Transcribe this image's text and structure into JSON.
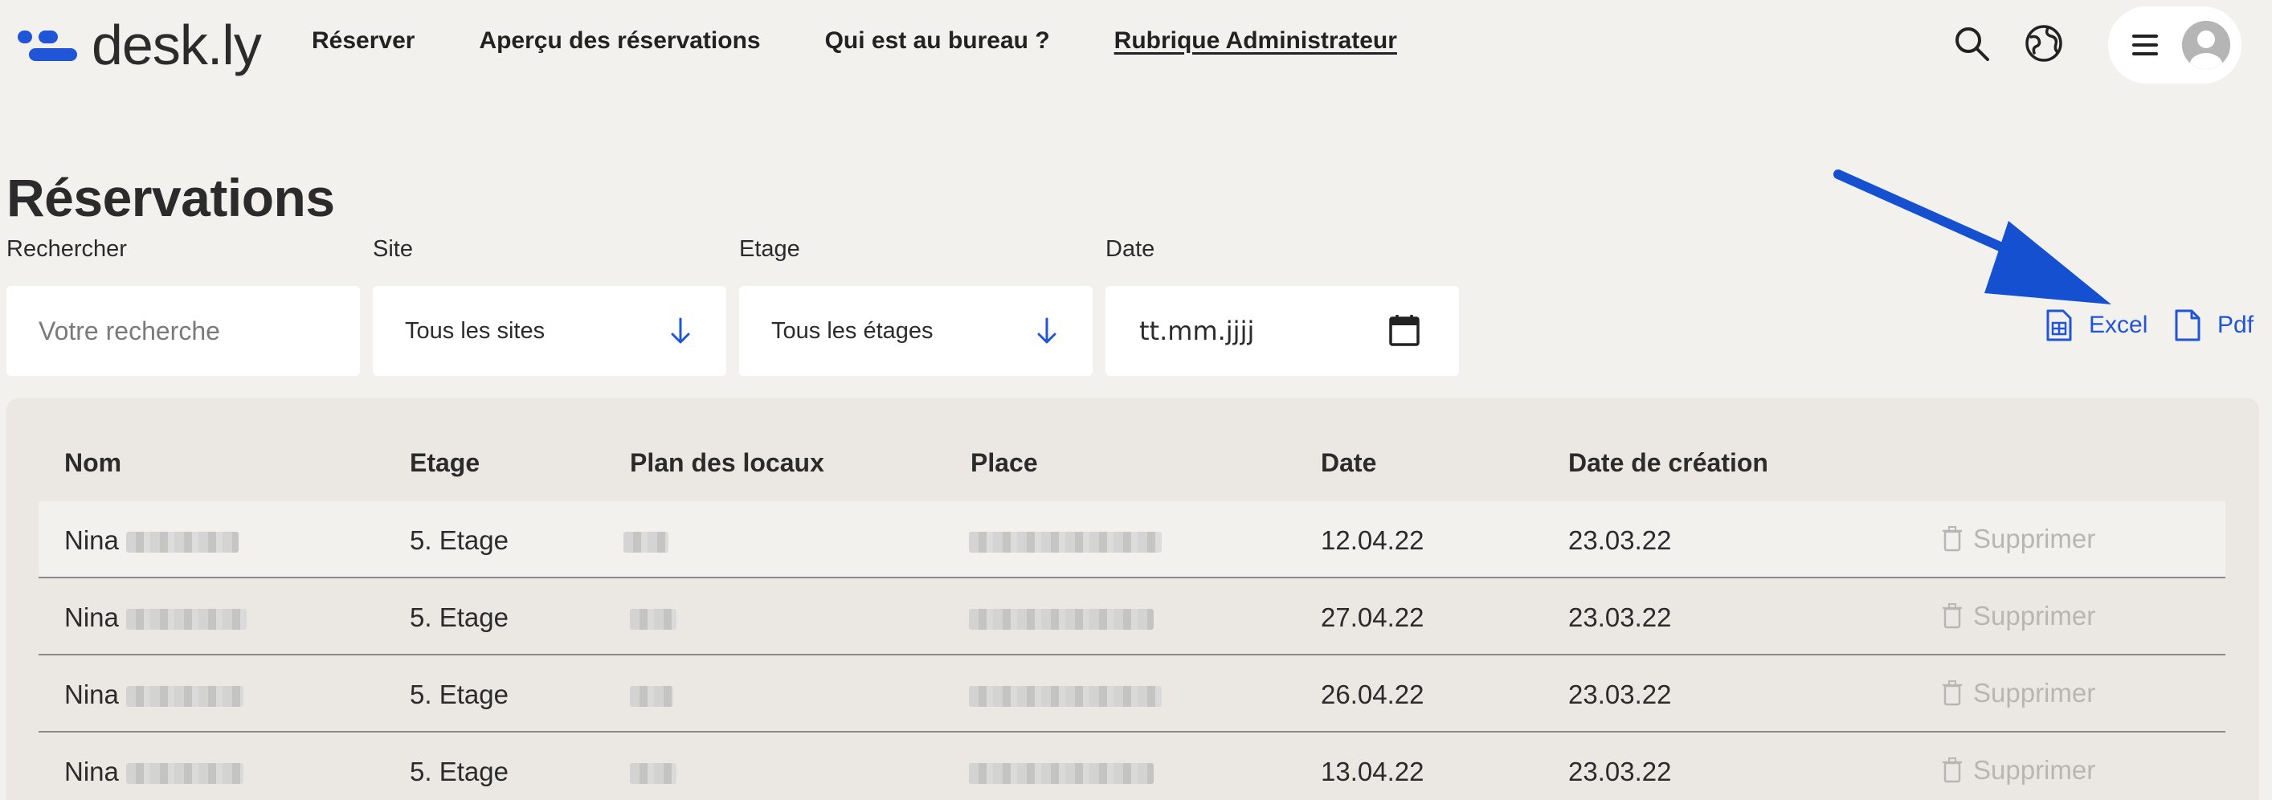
{
  "app": {
    "logo_text": "desk.ly",
    "brand_color": "#1f55d6"
  },
  "nav": [
    {
      "label": "Réserver",
      "active": false
    },
    {
      "label": "Aperçu des réservations",
      "active": false
    },
    {
      "label": "Qui est au bureau ?",
      "active": false
    },
    {
      "label": "Rubrique Administrateur",
      "active": true
    }
  ],
  "header_icons": [
    "search-icon",
    "globe-icon",
    "menu-icon",
    "avatar"
  ],
  "page": {
    "title": "Réservations"
  },
  "filters": {
    "search": {
      "label": "Rechercher",
      "placeholder": "Votre recherche"
    },
    "site": {
      "label": "Site",
      "value": "Tous les sites"
    },
    "floor": {
      "label": "Etage",
      "value": "Tous les étages"
    },
    "date": {
      "label": "Date",
      "placeholder": "tt.mm.jjjj"
    }
  },
  "export": {
    "excel_label": "Excel",
    "pdf_label": "Pdf"
  },
  "table": {
    "columns": [
      "Nom",
      "Etage",
      "Plan des locaux",
      "Place",
      "Date",
      "Date de création"
    ],
    "delete_label": "Supprimer",
    "rows": [
      {
        "name": "Nina",
        "floor": "5. Etage",
        "date": "12.04.22",
        "created": "23.03.22"
      },
      {
        "name": "Nina",
        "floor": "5. Etage",
        "date": "27.04.22",
        "created": "23.03.22"
      },
      {
        "name": "Nina",
        "floor": "5. Etage",
        "date": "26.04.22",
        "created": "23.03.22"
      },
      {
        "name": "Nina",
        "floor": "5. Etage",
        "date": "13.04.22",
        "created": "23.03.22"
      }
    ]
  }
}
